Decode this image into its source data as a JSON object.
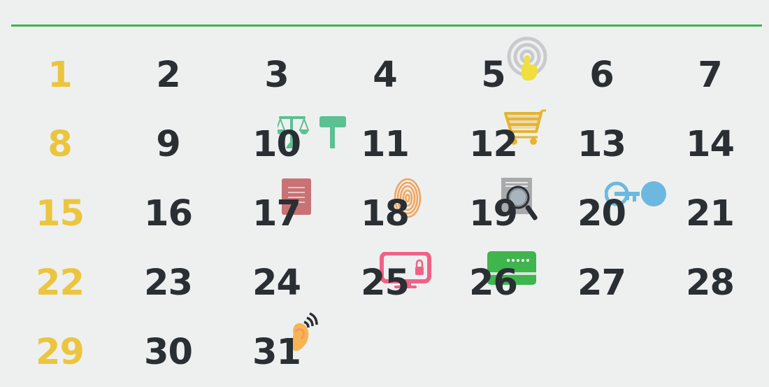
{
  "colors": {
    "accent_rule": "#3fb54d",
    "weekend_number": "#ebc53e",
    "weekday_number": "#2a2f33",
    "background": "#eef0f0"
  },
  "calendar": {
    "days": [
      {
        "label": "1",
        "weekend": true
      },
      {
        "label": "2"
      },
      {
        "label": "3"
      },
      {
        "label": "4"
      },
      {
        "label": "5",
        "icon": "touch-icon"
      },
      {
        "label": "6"
      },
      {
        "label": "7"
      },
      {
        "label": "8",
        "weekend": true
      },
      {
        "label": "9"
      },
      {
        "label": "10",
        "icon": "law-icon"
      },
      {
        "label": "11"
      },
      {
        "label": "12",
        "icon": "shopping-cart-icon"
      },
      {
        "label": "13"
      },
      {
        "label": "14"
      },
      {
        "label": "15",
        "weekend": true
      },
      {
        "label": "16"
      },
      {
        "label": "17",
        "icon": "document-icon"
      },
      {
        "label": "18",
        "icon": "fingerprint-icon"
      },
      {
        "label": "19",
        "icon": "document-search-icon"
      },
      {
        "label": "20",
        "icon": "key-token-icon"
      },
      {
        "label": "21"
      },
      {
        "label": "22",
        "weekend": true
      },
      {
        "label": "23"
      },
      {
        "label": "24"
      },
      {
        "label": "25",
        "icon": "secure-monitor-icon"
      },
      {
        "label": "26",
        "icon": "password-card-icon"
      },
      {
        "label": "27"
      },
      {
        "label": "28"
      },
      {
        "label": "29",
        "weekend": true
      },
      {
        "label": "30"
      },
      {
        "label": "31",
        "icon": "ear-signal-icon"
      }
    ]
  }
}
